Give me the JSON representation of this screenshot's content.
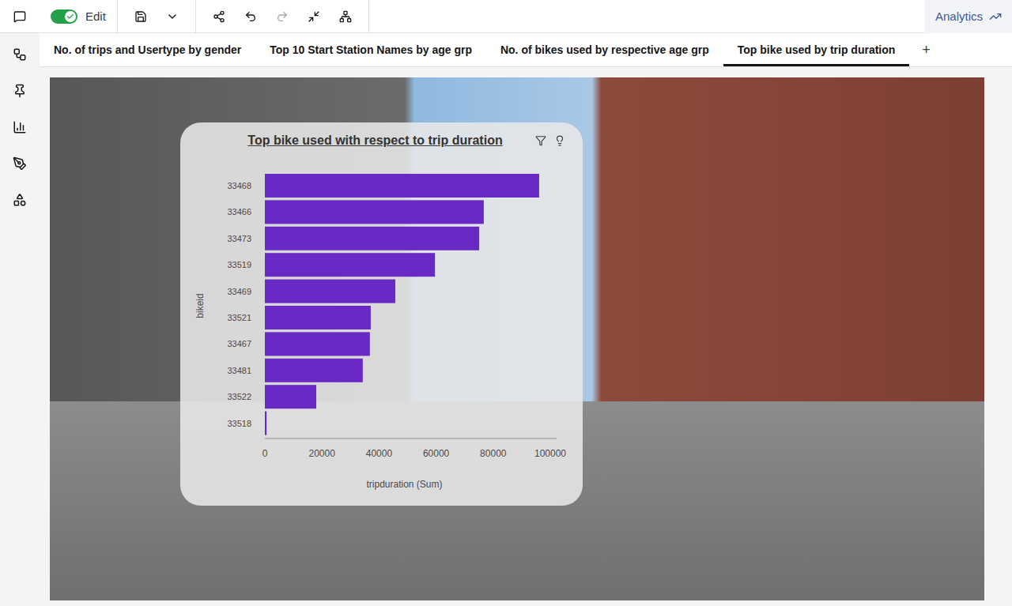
{
  "toolbar": {
    "edit": {
      "label": "Edit",
      "on": true
    },
    "redo_disabled": true,
    "app_label": "Analytics"
  },
  "tabs": [
    {
      "label": "No. of trips and Usertype by gender",
      "selected": false
    },
    {
      "label": "Top 10 Start Station Names by age grp",
      "selected": false
    },
    {
      "label": "No. of bikes used by respective age grp",
      "selected": false
    },
    {
      "label": "Top bike used by trip duration",
      "selected": true
    }
  ],
  "add_tab": "+",
  "chart": {
    "title": "Top bike used with respect to trip duration",
    "y_axis_label": "bikeid",
    "x_axis_label": "tripduration (Sum)",
    "x_ticks": [
      "0",
      "20000",
      "40000",
      "60000",
      "80000",
      "100000"
    ],
    "categories": [
      "33468",
      "33466",
      "33473",
      "33519",
      "33469",
      "33521",
      "33467",
      "33481",
      "33522",
      "33518"
    ],
    "series": [
      {
        "name": "tripduration (Sum)",
        "values": [
          96100,
          76700,
          75100,
          59600,
          45700,
          37100,
          36800,
          34300,
          18000,
          600
        ]
      }
    ]
  }
}
